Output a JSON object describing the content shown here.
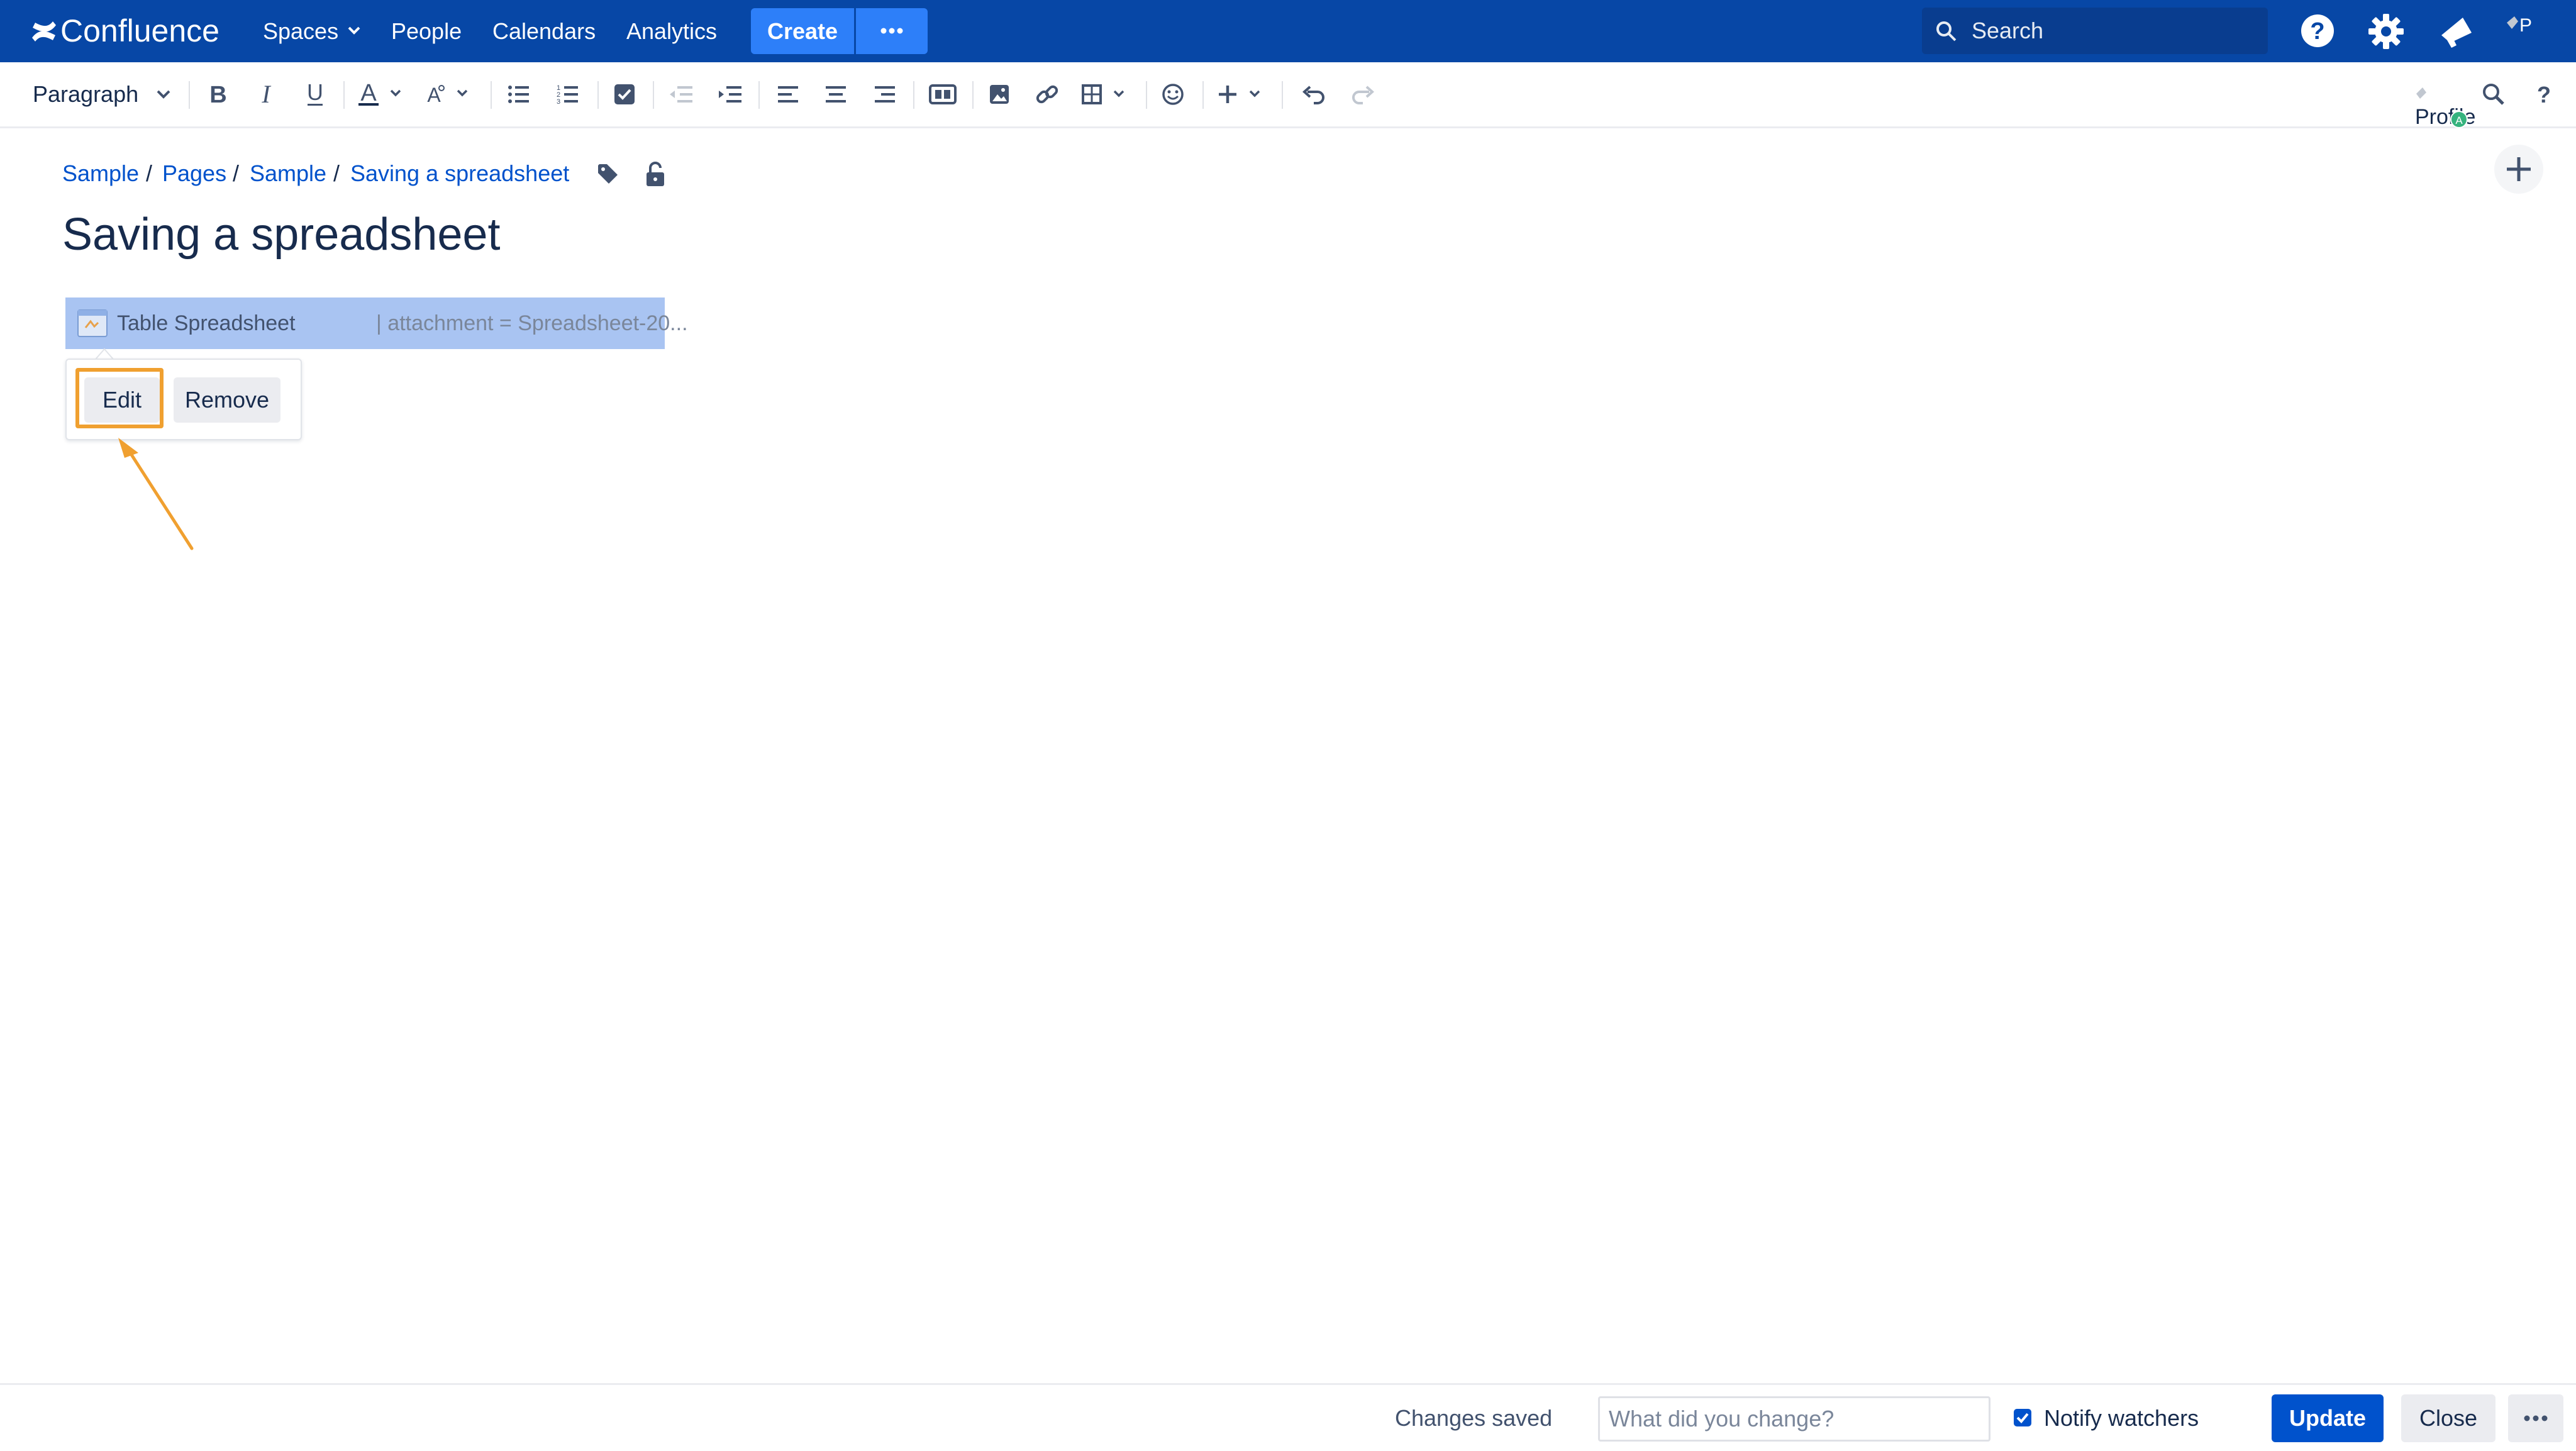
{
  "app": {
    "name": "Confluence",
    "accent": "#0747a6"
  },
  "topnav": {
    "spaces": "Spaces",
    "people": "People",
    "calendars": "Calendars",
    "analytics": "Analytics",
    "create": "Create",
    "search_placeholder": "Search",
    "avatar_alt": "P"
  },
  "toolbar": {
    "paragraph_style": "Paragraph",
    "profile_alt": "Profile",
    "help": "?",
    "icons": [
      "bold",
      "italic",
      "underline",
      "text-color",
      "text-style",
      "bullet-list",
      "numbered-list",
      "task-list",
      "outdent",
      "indent",
      "align-left",
      "align-center",
      "align-right",
      "page-layout",
      "image",
      "link",
      "table",
      "emoji",
      "insert-more",
      "undo",
      "redo",
      "find",
      "help"
    ]
  },
  "breadcrumbs": [
    "Sample",
    "Pages",
    "Sample",
    "Saving a spreadsheet"
  ],
  "breadcrumb_separator": "/",
  "page": {
    "title": "Saving a spreadsheet"
  },
  "macro": {
    "name": "Table Spreadsheet",
    "params": "| attachment = Spreadsheet-20..."
  },
  "macro_popup": {
    "edit": "Edit",
    "remove": "Remove",
    "highlight_color": "#f0a030"
  },
  "bottombar": {
    "status": "Changes saved",
    "comment_placeholder": "What did you change?",
    "notify_label": "Notify watchers",
    "notify_checked": true,
    "update": "Update",
    "close": "Close"
  }
}
